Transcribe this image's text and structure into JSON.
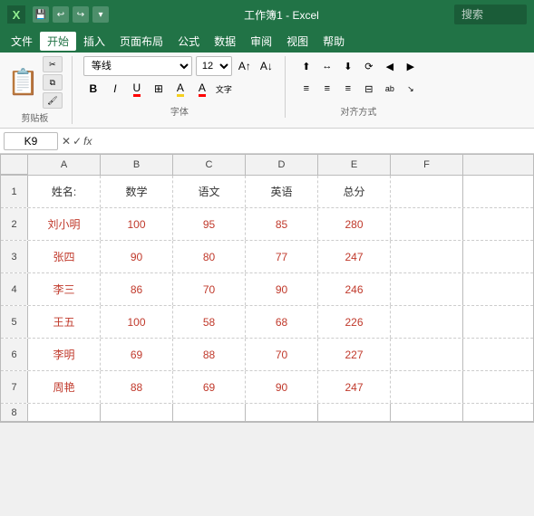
{
  "titlebar": {
    "title": "工作簿1 - Excel",
    "search_placeholder": "搜索"
  },
  "menu": {
    "items": [
      "文件",
      "开始",
      "插入",
      "页面布局",
      "公式",
      "数据",
      "审阅",
      "视图",
      "帮助"
    ]
  },
  "ribbon": {
    "paste_label": "粘贴",
    "clipboard_label": "剪贴板",
    "font_name": "等线",
    "font_size": "12",
    "font_label": "字体",
    "bold": "B",
    "italic": "I",
    "underline": "U",
    "align_label": "对齐方式"
  },
  "formulabar": {
    "cell_ref": "K9",
    "formula": ""
  },
  "spreadsheet": {
    "col_headers": [
      "A",
      "B",
      "C",
      "D",
      "E",
      "F"
    ],
    "rows": [
      {
        "row_num": "1",
        "cells": [
          "姓名:",
          "数学",
          "语文",
          "英语",
          "总分",
          ""
        ]
      },
      {
        "row_num": "2",
        "cells": [
          "刘小明",
          "100",
          "95",
          "85",
          "280",
          ""
        ]
      },
      {
        "row_num": "3",
        "cells": [
          "张四",
          "90",
          "80",
          "77",
          "247",
          ""
        ]
      },
      {
        "row_num": "4",
        "cells": [
          "李三",
          "86",
          "70",
          "90",
          "246",
          ""
        ]
      },
      {
        "row_num": "5",
        "cells": [
          "王五",
          "100",
          "58",
          "68",
          "226",
          ""
        ]
      },
      {
        "row_num": "6",
        "cells": [
          "李明",
          "69",
          "88",
          "70",
          "227",
          ""
        ]
      },
      {
        "row_num": "7",
        "cells": [
          "周艳",
          "88",
          "69",
          "90",
          "247",
          ""
        ]
      },
      {
        "row_num": "8",
        "cells": [
          "",
          "",
          "",
          "",
          "",
          ""
        ]
      }
    ]
  }
}
